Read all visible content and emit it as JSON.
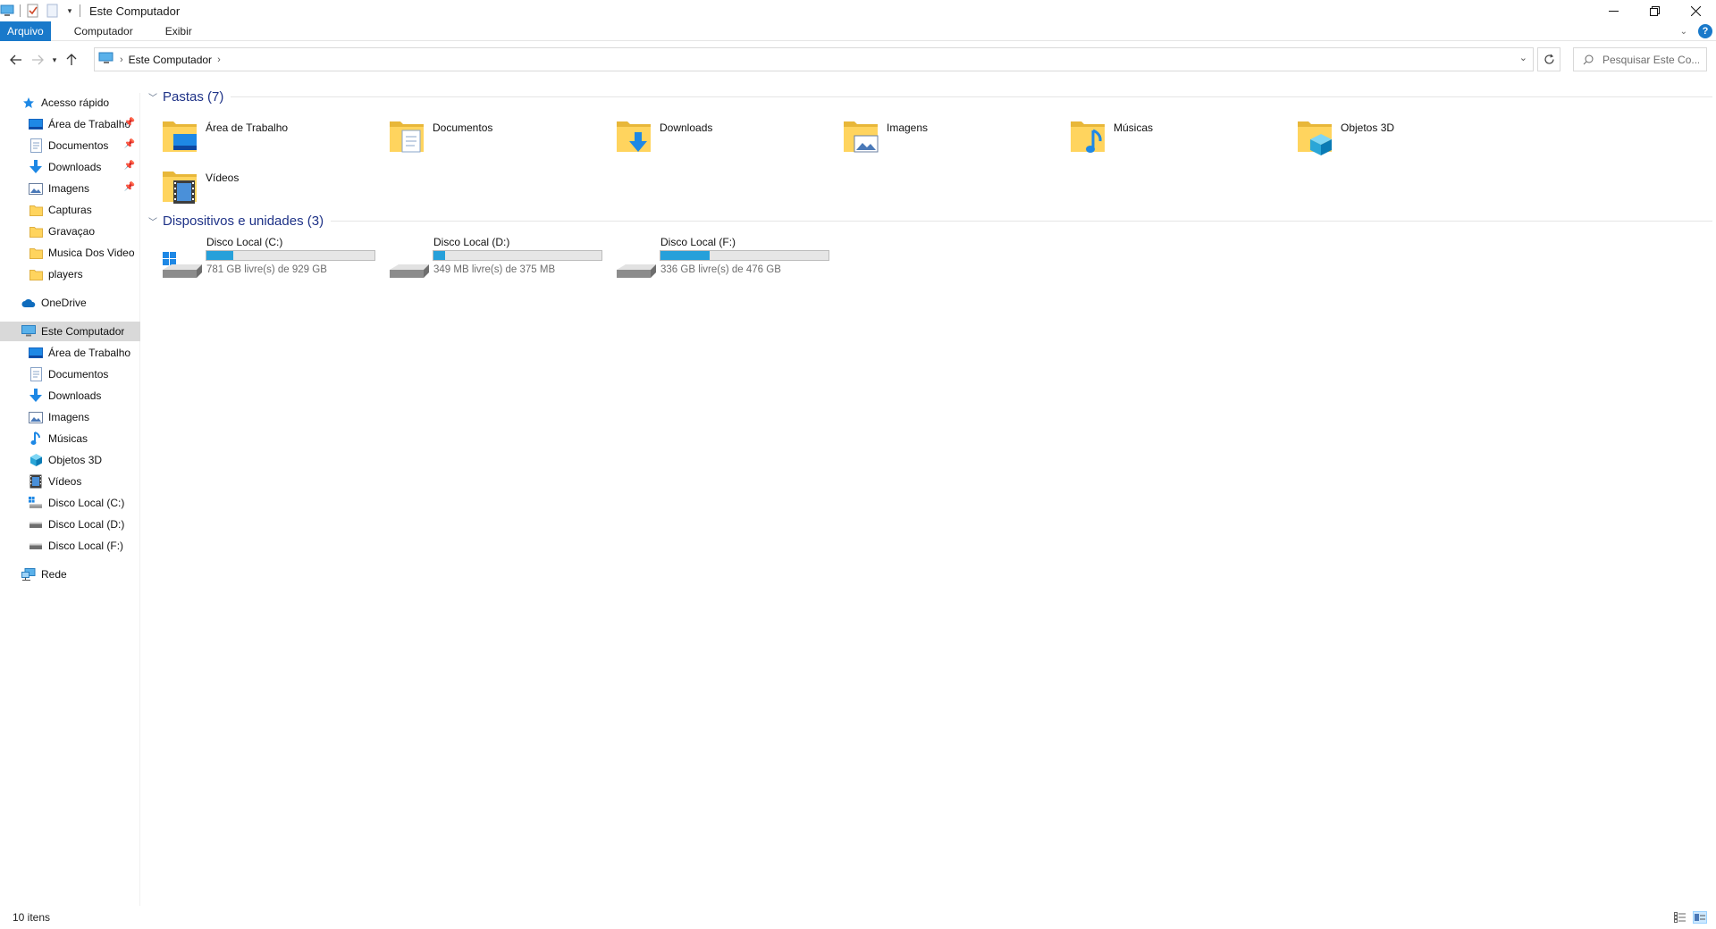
{
  "window": {
    "title": "Este Computador"
  },
  "ribbon": {
    "tabs": [
      "Arquivo",
      "Computador",
      "Exibir"
    ]
  },
  "address_bar": {
    "breadcrumb": "Este Computador"
  },
  "search": {
    "placeholder": "Pesquisar Este Co..."
  },
  "sidebar": {
    "quick_access": "Acesso rápido",
    "quick_items": [
      {
        "label": "Área de Trabalho",
        "pinned": true
      },
      {
        "label": "Documentos",
        "pinned": true
      },
      {
        "label": "Downloads",
        "pinned": true
      },
      {
        "label": "Imagens",
        "pinned": true
      },
      {
        "label": "Capturas",
        "pinned": false
      },
      {
        "label": "Gravaçao",
        "pinned": false
      },
      {
        "label": "Musica Dos Video",
        "pinned": false
      },
      {
        "label": "players",
        "pinned": false
      }
    ],
    "onedrive": "OneDrive",
    "this_pc": "Este Computador",
    "pc_items": [
      "Área de Trabalho",
      "Documentos",
      "Downloads",
      "Imagens",
      "Músicas",
      "Objetos 3D",
      "Vídeos",
      "Disco Local (C:)",
      "Disco Local (D:)",
      "Disco Local (F:)"
    ],
    "network": "Rede"
  },
  "main": {
    "folders_header": "Pastas (7)",
    "folders": [
      "Área de Trabalho",
      "Documentos",
      "Downloads",
      "Imagens",
      "Músicas",
      "Objetos 3D",
      "Vídeos"
    ],
    "drives_header": "Dispositivos e unidades (3)",
    "drives": [
      {
        "name": "Disco Local (C:)",
        "free_text": "781 GB livre(s) de 929 GB",
        "used_fraction": 0.16
      },
      {
        "name": "Disco Local (D:)",
        "free_text": "349 MB livre(s) de 375 MB",
        "used_fraction": 0.07
      },
      {
        "name": "Disco Local (F:)",
        "free_text": "336 GB livre(s) de 476 GB",
        "used_fraction": 0.29
      }
    ]
  },
  "status": {
    "item_count": "10 itens"
  },
  "colors": {
    "accent": "#1979ca",
    "drive_fill": "#26a0da",
    "group_title": "#1e3287",
    "folder_yellow": "#ffd45e"
  }
}
